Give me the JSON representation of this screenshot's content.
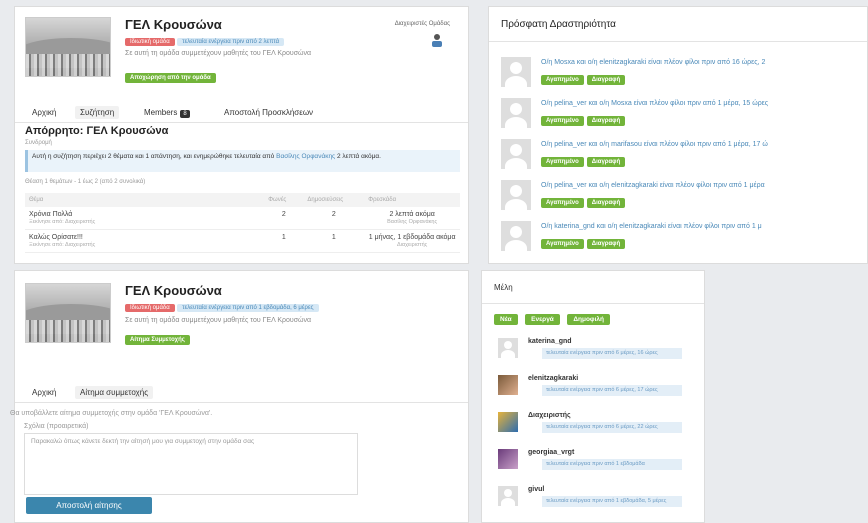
{
  "group_name": "ΓΕΛ Κρουσώνα",
  "group_description": "Σε αυτή τη ομάδα συμμετέχουν μαθητές του ΓΕΛ Κρουσώνα",
  "top_panel": {
    "privacy_badge": "Ιδιωτική ομάδα",
    "activity_badge": "τελευταία ενέργεια πριν από 2 λεπτά",
    "leave_button": "Αποχώρηση από την ομάδα",
    "admins_label": "Διαχειριστές Ομάδας",
    "tabs": [
      {
        "label": "Αρχική"
      },
      {
        "label": "Συζήτηση"
      },
      {
        "label": "Members",
        "count": "8"
      },
      {
        "label": "Αποστολή Προσκλήσεων"
      }
    ],
    "topic_title": "Απόρρητο: ΓΕΛ Κρουσώνα",
    "subscribe": "Συνδρομή",
    "notice_text": "Αυτή η συζήτηση περιέχει 2 θέματα και 1 απάντηση, και ενημερώθηκε τελευταία από",
    "notice_user": "Βασίλης Ορφανάκης",
    "notice_time": "2 λεπτά ακόμα.",
    "viewing": "Θέαση 1 θεμάτων - 1 έως 2 (από 2 συνολικά)",
    "table": {
      "headers": [
        "Θέμα",
        "Φωνές",
        "Δημοσιεύσεις",
        "Φρεσκάδα"
      ],
      "rows": [
        {
          "topic": "Χρόνια Πολλά",
          "by": "Ξεκίνησε από: Διαχειριστής",
          "voices": "2",
          "posts": "2",
          "fresh": "2 λεπτά ακόμα",
          "fresh_by": "Βασίλης Ορφανάκης"
        },
        {
          "topic": "Καλώς Ορίσατε!!!",
          "by": "Ξεκίνησε από: Διαχειριστής",
          "voices": "1",
          "posts": "1",
          "fresh": "1 μήνας, 1 εβδομάδα ακόμα",
          "fresh_by": "Διαχειριστής"
        }
      ]
    }
  },
  "activity": {
    "title": "Πρόσφατη Δραστηριότητα",
    "accept_label": "Αγαπημένο",
    "delete_label": "Διαγραφή",
    "items": [
      {
        "text": "Ο/η Mosxa και ο/η elenitzagkaraki είναι πλέον φίλοι πριν από 16 ώρες, 2"
      },
      {
        "text": "Ο/η pelina_ver και ο/η Mosxa είναι πλέον φίλοι πριν από 1 μέρα, 15 ώρες"
      },
      {
        "text": "Ο/η pelina_ver και ο/η marifasou είναι πλέον φίλοι πριν από 1 μέρα, 17 ώ"
      },
      {
        "text": "Ο/η pelina_ver και ο/η elenitzagkaraki είναι πλέον φίλοι πριν από 1 μέρα"
      },
      {
        "text": "Ο/η katerina_gnd και ο/η elenitzagkaraki είναι πλέον φίλοι πριν από 1 μ"
      }
    ]
  },
  "bottom_panel": {
    "privacy_badge": "Ιδιωτική ομάδα",
    "activity_badge": "τελευταία ενέργεια πριν από 1 εβδομάδα, 6 μέρες",
    "request_button": "Αίτημα Συμμετοχής",
    "tabs": [
      {
        "label": "Αρχική"
      },
      {
        "label": "Αίτημα συμμετοχής"
      }
    ],
    "intro": "Θα υποβάλλετε αίτημα συμμετοχής στην ομάδα 'ΓΕΛ Κρουσώνα'.",
    "comments_label": "Σχόλια (προαιρετικά)",
    "textarea_placeholder": "Παρακαλώ όπως κάνετε δεκτή την αίτησή μου για συμμετοχή στην ομάδα σας",
    "submit": "Αποστολή αίτησης"
  },
  "members": {
    "title": "Μέλη",
    "filters": [
      "Νέα",
      "Ενεργά",
      "Δημοφιλή"
    ],
    "list": [
      {
        "name": "katerina_gnd",
        "status": "τελευταία ενέργεια πριν από 6 μέρες, 16 ώρες"
      },
      {
        "name": "elenitzagkaraki",
        "status": "τελευταία ενέργεια πριν από 6 μέρες, 17 ώρες"
      },
      {
        "name": "Διαχειριστής",
        "status": "τελευταία ενέργεια πριν από 6 μέρες, 22 ώρες"
      },
      {
        "name": "georgiaa_vrgt",
        "status": "τελευταία ενέργεια πριν από 1 εβδομάδα"
      },
      {
        "name": "givul",
        "status": "τελευταία ενέργεια πριν από 1 εβδομάδα, 5 μέρες"
      }
    ]
  },
  "colors": {
    "accent_green": "#72b43a",
    "button_blue": "#3b86ad",
    "link_blue": "#4a89b8",
    "badge_red": "#e56a6a"
  }
}
